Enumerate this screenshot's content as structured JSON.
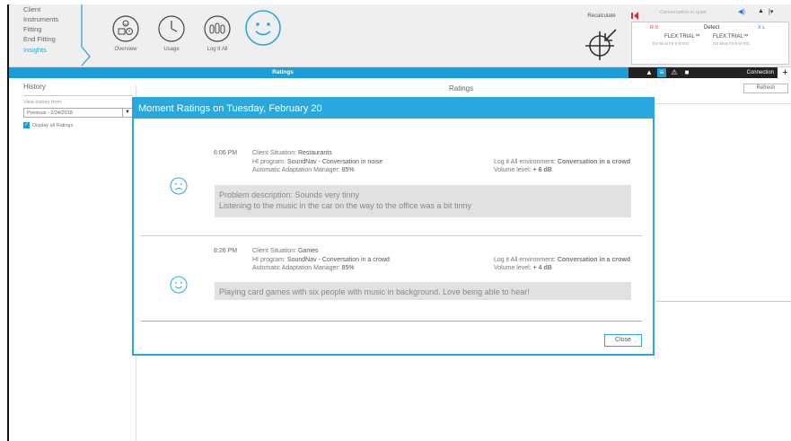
{
  "nav": {
    "items": [
      {
        "label": "Client",
        "active": false
      },
      {
        "label": "Instruments",
        "active": false
      },
      {
        "label": "Fitting",
        "active": false
      },
      {
        "label": "End Fitting",
        "active": false
      },
      {
        "label": "Insights",
        "active": true
      }
    ]
  },
  "toolbar": {
    "buttons": [
      {
        "label": "Overview",
        "icon": "overview-icon"
      },
      {
        "label": "Usage",
        "icon": "clock-icon"
      },
      {
        "label": "Log It All",
        "icon": "log-it-all-icon"
      },
      {
        "label": "",
        "icon": "smiley-ratings-icon"
      }
    ]
  },
  "recalculate": {
    "label": "Recalculate"
  },
  "program": {
    "conversation_field": "Conversation in quiet"
  },
  "devices": {
    "left_status": "R X",
    "detect_label": "Detect",
    "right_status": "X L",
    "left_name": "FLEX:TRIAL™",
    "right_name": "FLEX:TRIAL™",
    "left_model": "DX Mosi Fit 9 M RIC",
    "right_model": "DX Mosi Fit 9 M RIC"
  },
  "strip": {
    "tab_label": "Ratings",
    "connection_label": "Connection",
    "plus_label": "+"
  },
  "history": {
    "title": "History",
    "view_from_label": "View history from:",
    "select_value": "Previous - 2/24/2018",
    "display_all_label": "Display all Ratings"
  },
  "ratings_panel": {
    "title": "Ratings",
    "refresh_label": "Refresh"
  },
  "modal": {
    "title": "Moment Ratings on Tuesday, February 20",
    "close_label": "Close",
    "entries": [
      {
        "time": "6:06 PM",
        "face": "sad",
        "client_situation_label": "Client Situation:",
        "client_situation": "Restaurants",
        "hi_program_label": "HI program:",
        "hi_program": "SoundNav - Conversation in noise",
        "aam_label": "Automatic Adaptation Manager:",
        "aam": "85%",
        "env_label": "Log it All environment:",
        "env": "Conversation in a crowd",
        "volume_label": "Volume level:",
        "volume": "+ 6 dB",
        "desc_line1": "Problem description:  Sounds very tinny",
        "desc_line2": "Listening to the music in the car on the way to the office was a bit tinny"
      },
      {
        "time": "8:26 PM",
        "face": "happy",
        "client_situation_label": "Client Situation:",
        "client_situation": "Games",
        "hi_program_label": "HI program:",
        "hi_program": "SoundNav - Conversation in a crowd",
        "aam_label": "Automatic Adaptation Manager:",
        "aam": "85%",
        "env_label": "Log it All environment:",
        "env": "Conversation in a crowd",
        "volume_label": "Volume level:",
        "volume": "+ 4 dB",
        "desc_line1": "Playing card games with six people with music in background. Love being able to hear!",
        "desc_line2": ""
      }
    ]
  },
  "colors": {
    "accent": "#29a8e0",
    "strip": "#1a9ed9",
    "status_red": "#e03030",
    "status_blue": "#2a6fd6"
  }
}
